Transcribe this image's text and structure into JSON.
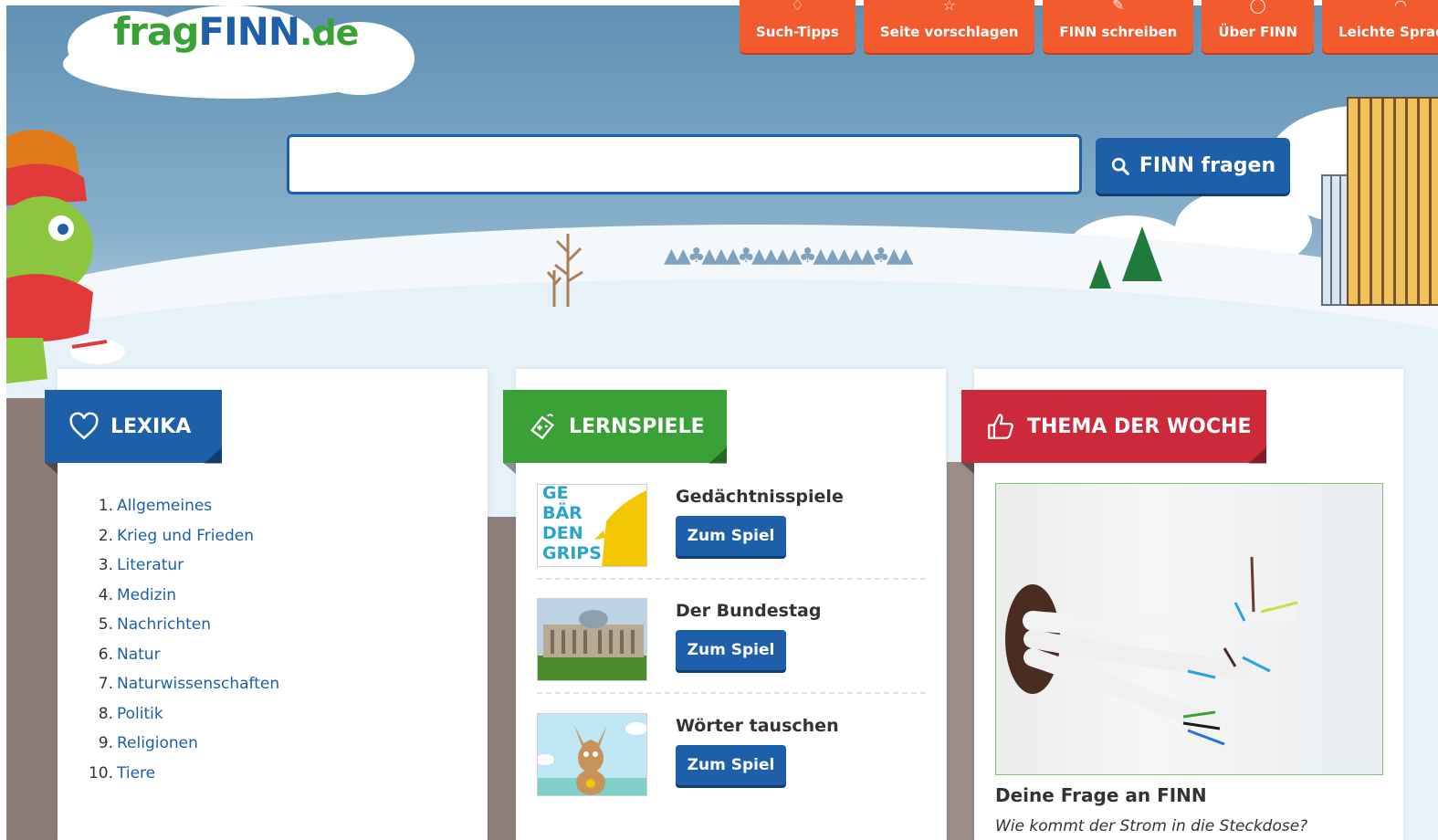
{
  "logo": {
    "part1": "frag",
    "part2": "FINN",
    "part3": ".de"
  },
  "topnav": [
    {
      "label": "Such-Tipps",
      "icon": "lightbulb-icon"
    },
    {
      "label": "Seite vorschlagen",
      "icon": "star-icon"
    },
    {
      "label": "FINN schreiben",
      "icon": "pencil-icon"
    },
    {
      "label": "Über FINN",
      "icon": "question-icon"
    },
    {
      "label": "Leichte Sprache",
      "icon": "speech-bubble-icon"
    }
  ],
  "search": {
    "value": "",
    "placeholder": "",
    "button_label": "FINN fragen"
  },
  "lexika": {
    "title": "LEXIKA",
    "items": [
      {
        "num": "1.",
        "label": "Allgemeines"
      },
      {
        "num": "2.",
        "label": "Krieg und Frieden"
      },
      {
        "num": "3.",
        "label": "Literatur"
      },
      {
        "num": "4.",
        "label": "Medizin"
      },
      {
        "num": "5.",
        "label": "Nachrichten"
      },
      {
        "num": "6.",
        "label": "Natur"
      },
      {
        "num": "7.",
        "label": "Naturwissenschaften"
      },
      {
        "num": "8.",
        "label": "Politik"
      },
      {
        "num": "9.",
        "label": "Religionen"
      },
      {
        "num": "10.",
        "label": "Tiere"
      }
    ]
  },
  "lernspiele": {
    "title": "LERNSPIELE",
    "games": [
      {
        "title": "Gedächtnisspiele",
        "button": "Zum Spiel",
        "thumb_text": [
          "GE",
          "BÄR",
          "DEN",
          "GRIPS"
        ]
      },
      {
        "title": "Der Bundestag",
        "button": "Zum Spiel"
      },
      {
        "title": "Wörter tauschen",
        "button": "Zum Spiel"
      }
    ]
  },
  "thema": {
    "title": "THEMA DER WOCHE",
    "headline": "Deine Frage an FINN",
    "subline": "Wie kommt der Strom in die Steckdose?"
  },
  "colors": {
    "blue": "#1d5fa8",
    "green": "#3aa136",
    "red": "#cc2a3a",
    "orange": "#f25b2e"
  }
}
